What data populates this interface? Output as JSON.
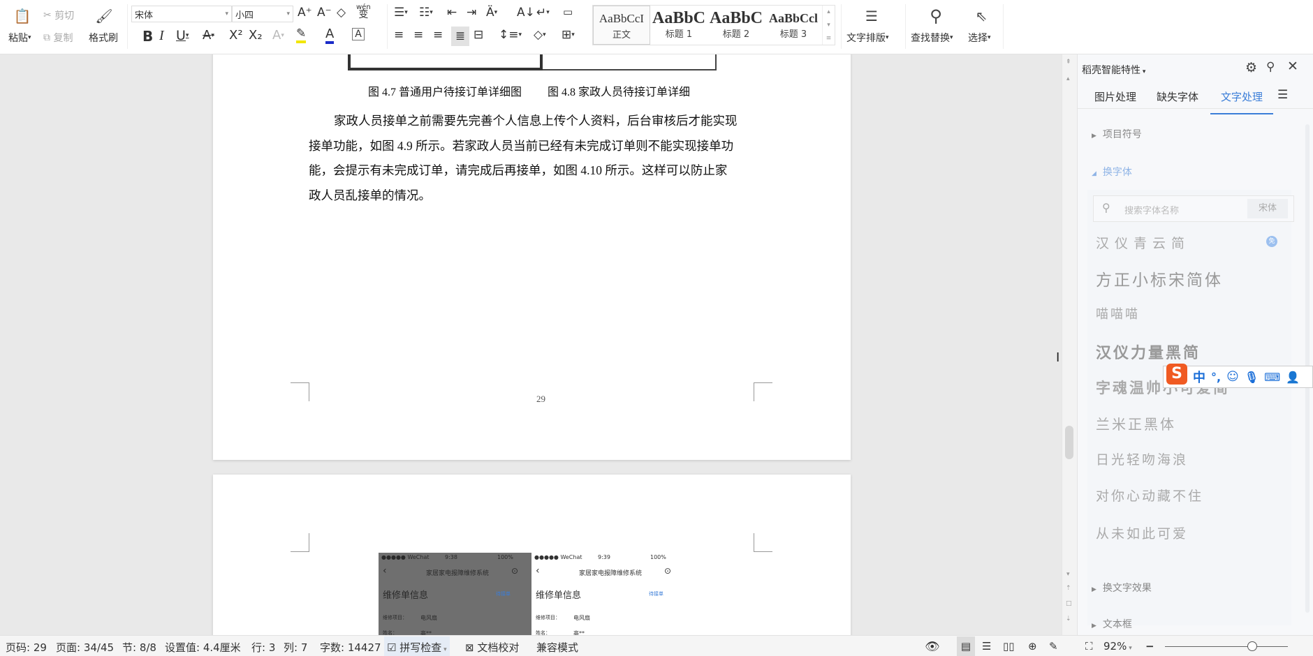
{
  "toolbar": {
    "paste": "粘贴",
    "cut": "剪切",
    "copy": "复制",
    "format_painter": "格式刷",
    "font_name": "宋体",
    "font_size": "小四",
    "phonetic": "wén",
    "styles": [
      {
        "preview": "AaBbCcI",
        "label": "正文"
      },
      {
        "preview": "AaBbC",
        "label": "标题 1"
      },
      {
        "preview": "AaBbC",
        "label": "标题 2"
      },
      {
        "preview": "AaBbCcl",
        "label": "标题 3"
      }
    ],
    "text_layout": "文字排版",
    "find_replace": "查找替换",
    "select": "选择"
  },
  "document": {
    "caption_left": "图 4.7 普通用户待接订单详细图",
    "caption_right": "图 4.8 家政人员待接订单详细",
    "paragraph_lines": [
      "家政人员接单之前需要先完善个人信息上传个人资料，后台审核后才能实现",
      "接单功能，如图 4.9 所示。若家政人员当前已经有未完成订单则不能实现接单功",
      "能，会提示有未完成订单，请完成后再接单，如图 4.10 所示。这样可以防止家",
      "政人员乱接单的情况。"
    ],
    "page_number": "29",
    "phones": [
      {
        "status_left": "●●●●● WeChat",
        "time": "9:38",
        "battery": "100%",
        "title": "家居家电报障维修系统",
        "heading": "维修单信息",
        "badge": "待接单",
        "field_label": "维修项目：",
        "field_value": "电风扇",
        "field2_label": "姓名：",
        "field2_value": "高**"
      },
      {
        "status_left": "●●●●● WeChat",
        "time": "9:39",
        "battery": "100%",
        "title": "家居家电报障维修系统",
        "heading": "维修单信息",
        "badge": "待接单",
        "field_label": "维修项目：",
        "field_value": "电风扇",
        "field2_label": "姓名：",
        "field2_value": "高**"
      }
    ]
  },
  "panel": {
    "title": "稻壳智能特性",
    "tabs": [
      "图片处理",
      "缺失字体",
      "文字处理"
    ],
    "active_tab": 2,
    "section_bullets": "项目符号",
    "section_fonts": "换字体",
    "search_placeholder": "搜索字体名称",
    "current_font": "宋体",
    "fonts": [
      "汉仪青云简",
      "方正小标宋简体",
      "喵喵喵",
      "汉仪力量黑简",
      "字魂温帅小可爱简",
      "兰米正黑体",
      "日光轻吻海浪",
      "对你心动藏不住",
      "从未如此可爱"
    ],
    "section_effects": "换文字效果",
    "section_textbox": "文本框",
    "accent": "#3b7ed8"
  },
  "ime": {
    "lang": "中",
    "punct": "°,"
  },
  "status": {
    "page_code": "页码: 29",
    "page": "页面: 34/45",
    "section": "节: 8/8",
    "setting": "设置值: 4.4厘米",
    "row": "行: 3",
    "col": "列: 7",
    "words": "字数: 14427",
    "spell": "拼写检查",
    "proof": "文档校对",
    "compat": "兼容模式",
    "zoom": "92%",
    "zoom_value": 92
  }
}
